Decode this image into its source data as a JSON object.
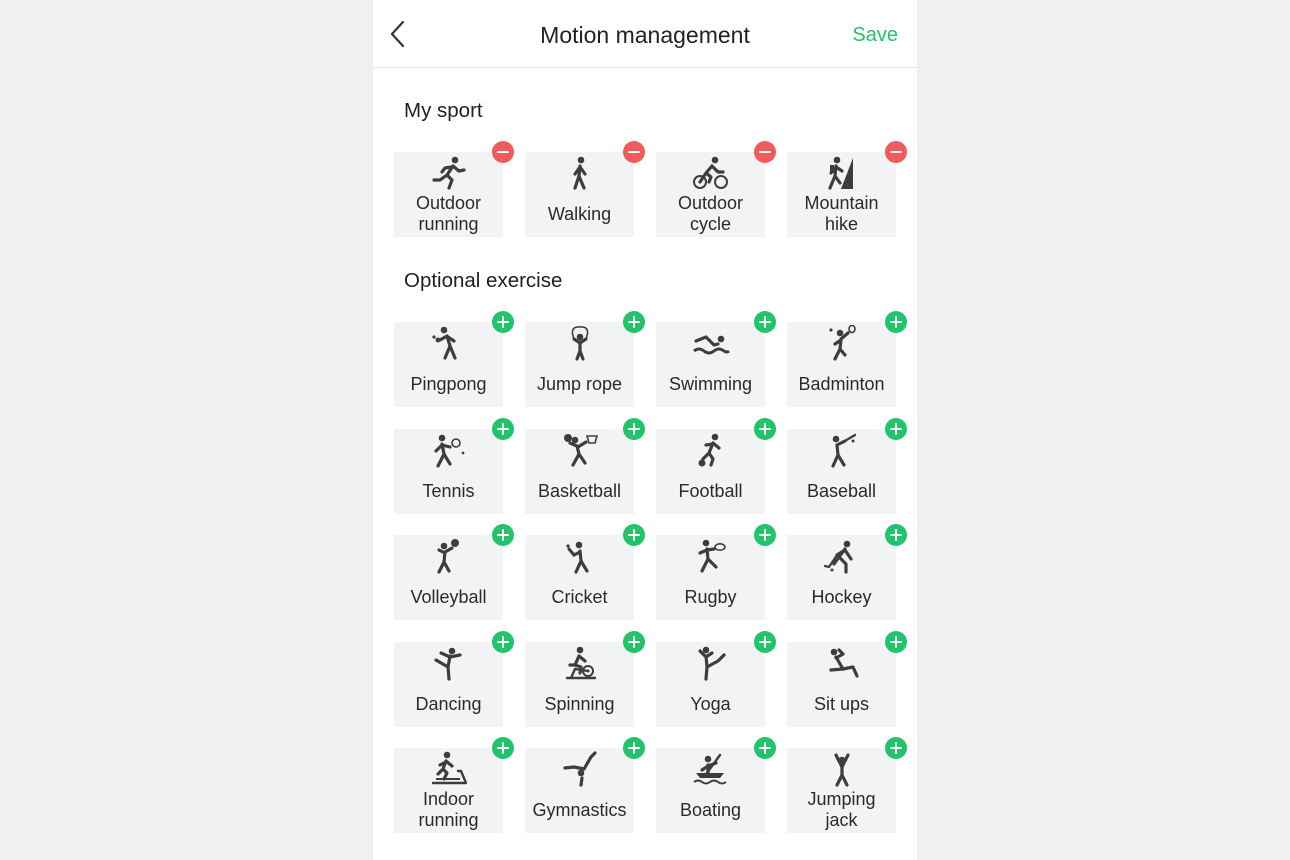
{
  "header": {
    "title": "Motion management",
    "save_label": "Save",
    "back_icon": "chevron-left-icon"
  },
  "colors": {
    "accent": "#22c36a",
    "remove": "#f05b5b",
    "icon": "#3d3d3d",
    "tile_bg": "#f2f3f5"
  },
  "my_sport": {
    "title": "My sport",
    "items": [
      {
        "label": "Outdoor running",
        "lines": [
          "Outdoor",
          "running"
        ],
        "icon": "runner-icon"
      },
      {
        "label": "Walking",
        "lines": [
          "Walking"
        ],
        "icon": "walker-icon"
      },
      {
        "label": "Outdoor cycle",
        "lines": [
          "Outdoor",
          "cycle"
        ],
        "icon": "cyclist-icon"
      },
      {
        "label": "Mountain hike",
        "lines": [
          "Mountain",
          "hike"
        ],
        "icon": "hiker-icon"
      }
    ]
  },
  "optional": {
    "title": "Optional exercise",
    "items": [
      {
        "label": "Pingpong",
        "lines": [
          "Pingpong"
        ],
        "icon": "pingpong-icon"
      },
      {
        "label": "Jump rope",
        "lines": [
          "Jump rope"
        ],
        "icon": "jump-rope-icon"
      },
      {
        "label": "Swimming",
        "lines": [
          "Swimming"
        ],
        "icon": "swimmer-icon"
      },
      {
        "label": "Badminton",
        "lines": [
          "Badminton"
        ],
        "icon": "badminton-icon"
      },
      {
        "label": "Tennis",
        "lines": [
          "Tennis"
        ],
        "icon": "tennis-icon"
      },
      {
        "label": "Basketball",
        "lines": [
          "Basketball"
        ],
        "icon": "basketball-icon"
      },
      {
        "label": "Football",
        "lines": [
          "Football"
        ],
        "icon": "football-icon"
      },
      {
        "label": "Baseball",
        "lines": [
          "Baseball"
        ],
        "icon": "baseball-icon"
      },
      {
        "label": "Volleyball",
        "lines": [
          "Volleyball"
        ],
        "icon": "volleyball-icon"
      },
      {
        "label": "Cricket",
        "lines": [
          "Cricket"
        ],
        "icon": "cricket-icon"
      },
      {
        "label": "Rugby",
        "lines": [
          "Rugby"
        ],
        "icon": "rugby-icon"
      },
      {
        "label": "Hockey",
        "lines": [
          "Hockey"
        ],
        "icon": "hockey-icon"
      },
      {
        "label": "Dancing",
        "lines": [
          "Dancing"
        ],
        "icon": "dancer-icon"
      },
      {
        "label": "Spinning",
        "lines": [
          "Spinning"
        ],
        "icon": "spinning-bike-icon"
      },
      {
        "label": "Yoga",
        "lines": [
          "Yoga"
        ],
        "icon": "yoga-icon"
      },
      {
        "label": "Sit ups",
        "lines": [
          "Sit ups"
        ],
        "icon": "sit-ups-icon"
      },
      {
        "label": "Indoor running",
        "lines": [
          "Indoor",
          "running"
        ],
        "icon": "treadmill-icon"
      },
      {
        "label": "Gymnastics",
        "lines": [
          "Gymnastics"
        ],
        "icon": "gymnast-icon"
      },
      {
        "label": "Boating",
        "lines": [
          "Boating"
        ],
        "icon": "boat-icon"
      },
      {
        "label": "Jumping jack",
        "lines": [
          "Jumping",
          "jack"
        ],
        "icon": "jumping-jack-icon"
      }
    ]
  }
}
